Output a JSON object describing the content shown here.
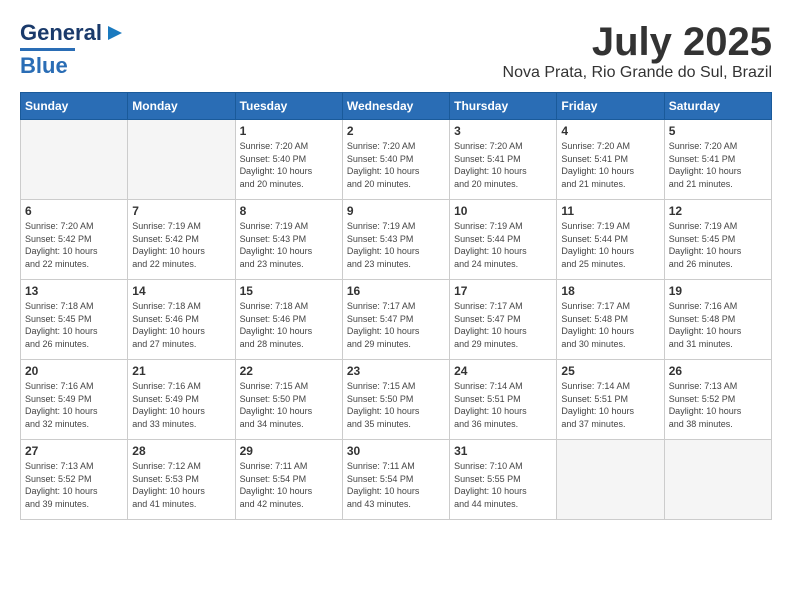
{
  "header": {
    "logo_general": "General",
    "logo_blue": "Blue",
    "month_title": "July 2025",
    "location": "Nova Prata, Rio Grande do Sul, Brazil"
  },
  "weekdays": [
    "Sunday",
    "Monday",
    "Tuesday",
    "Wednesday",
    "Thursday",
    "Friday",
    "Saturday"
  ],
  "weeks": [
    [
      {
        "day": "",
        "info": "",
        "empty": true
      },
      {
        "day": "",
        "info": "",
        "empty": true
      },
      {
        "day": "1",
        "info": "Sunrise: 7:20 AM\nSunset: 5:40 PM\nDaylight: 10 hours\nand 20 minutes."
      },
      {
        "day": "2",
        "info": "Sunrise: 7:20 AM\nSunset: 5:40 PM\nDaylight: 10 hours\nand 20 minutes."
      },
      {
        "day": "3",
        "info": "Sunrise: 7:20 AM\nSunset: 5:41 PM\nDaylight: 10 hours\nand 20 minutes."
      },
      {
        "day": "4",
        "info": "Sunrise: 7:20 AM\nSunset: 5:41 PM\nDaylight: 10 hours\nand 21 minutes."
      },
      {
        "day": "5",
        "info": "Sunrise: 7:20 AM\nSunset: 5:41 PM\nDaylight: 10 hours\nand 21 minutes."
      }
    ],
    [
      {
        "day": "6",
        "info": "Sunrise: 7:20 AM\nSunset: 5:42 PM\nDaylight: 10 hours\nand 22 minutes."
      },
      {
        "day": "7",
        "info": "Sunrise: 7:19 AM\nSunset: 5:42 PM\nDaylight: 10 hours\nand 22 minutes."
      },
      {
        "day": "8",
        "info": "Sunrise: 7:19 AM\nSunset: 5:43 PM\nDaylight: 10 hours\nand 23 minutes."
      },
      {
        "day": "9",
        "info": "Sunrise: 7:19 AM\nSunset: 5:43 PM\nDaylight: 10 hours\nand 23 minutes."
      },
      {
        "day": "10",
        "info": "Sunrise: 7:19 AM\nSunset: 5:44 PM\nDaylight: 10 hours\nand 24 minutes."
      },
      {
        "day": "11",
        "info": "Sunrise: 7:19 AM\nSunset: 5:44 PM\nDaylight: 10 hours\nand 25 minutes."
      },
      {
        "day": "12",
        "info": "Sunrise: 7:19 AM\nSunset: 5:45 PM\nDaylight: 10 hours\nand 26 minutes."
      }
    ],
    [
      {
        "day": "13",
        "info": "Sunrise: 7:18 AM\nSunset: 5:45 PM\nDaylight: 10 hours\nand 26 minutes."
      },
      {
        "day": "14",
        "info": "Sunrise: 7:18 AM\nSunset: 5:46 PM\nDaylight: 10 hours\nand 27 minutes."
      },
      {
        "day": "15",
        "info": "Sunrise: 7:18 AM\nSunset: 5:46 PM\nDaylight: 10 hours\nand 28 minutes."
      },
      {
        "day": "16",
        "info": "Sunrise: 7:17 AM\nSunset: 5:47 PM\nDaylight: 10 hours\nand 29 minutes."
      },
      {
        "day": "17",
        "info": "Sunrise: 7:17 AM\nSunset: 5:47 PM\nDaylight: 10 hours\nand 29 minutes."
      },
      {
        "day": "18",
        "info": "Sunrise: 7:17 AM\nSunset: 5:48 PM\nDaylight: 10 hours\nand 30 minutes."
      },
      {
        "day": "19",
        "info": "Sunrise: 7:16 AM\nSunset: 5:48 PM\nDaylight: 10 hours\nand 31 minutes."
      }
    ],
    [
      {
        "day": "20",
        "info": "Sunrise: 7:16 AM\nSunset: 5:49 PM\nDaylight: 10 hours\nand 32 minutes."
      },
      {
        "day": "21",
        "info": "Sunrise: 7:16 AM\nSunset: 5:49 PM\nDaylight: 10 hours\nand 33 minutes."
      },
      {
        "day": "22",
        "info": "Sunrise: 7:15 AM\nSunset: 5:50 PM\nDaylight: 10 hours\nand 34 minutes."
      },
      {
        "day": "23",
        "info": "Sunrise: 7:15 AM\nSunset: 5:50 PM\nDaylight: 10 hours\nand 35 minutes."
      },
      {
        "day": "24",
        "info": "Sunrise: 7:14 AM\nSunset: 5:51 PM\nDaylight: 10 hours\nand 36 minutes."
      },
      {
        "day": "25",
        "info": "Sunrise: 7:14 AM\nSunset: 5:51 PM\nDaylight: 10 hours\nand 37 minutes."
      },
      {
        "day": "26",
        "info": "Sunrise: 7:13 AM\nSunset: 5:52 PM\nDaylight: 10 hours\nand 38 minutes."
      }
    ],
    [
      {
        "day": "27",
        "info": "Sunrise: 7:13 AM\nSunset: 5:52 PM\nDaylight: 10 hours\nand 39 minutes."
      },
      {
        "day": "28",
        "info": "Sunrise: 7:12 AM\nSunset: 5:53 PM\nDaylight: 10 hours\nand 41 minutes."
      },
      {
        "day": "29",
        "info": "Sunrise: 7:11 AM\nSunset: 5:54 PM\nDaylight: 10 hours\nand 42 minutes."
      },
      {
        "day": "30",
        "info": "Sunrise: 7:11 AM\nSunset: 5:54 PM\nDaylight: 10 hours\nand 43 minutes."
      },
      {
        "day": "31",
        "info": "Sunrise: 7:10 AM\nSunset: 5:55 PM\nDaylight: 10 hours\nand 44 minutes."
      },
      {
        "day": "",
        "info": "",
        "empty": true
      },
      {
        "day": "",
        "info": "",
        "empty": true
      }
    ]
  ]
}
